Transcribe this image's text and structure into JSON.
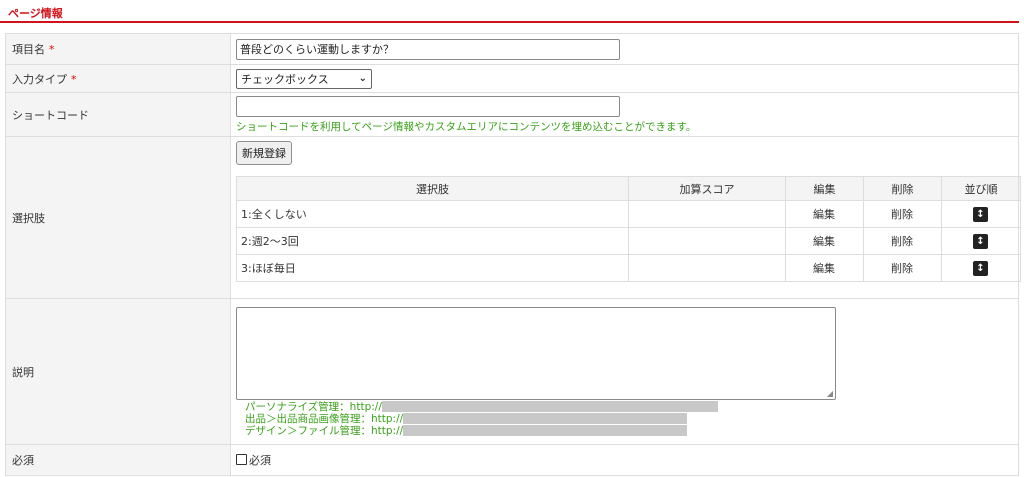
{
  "colors": {
    "accent": "#d0121b",
    "help_text": "#3aa11a",
    "required": "#e60000",
    "header_bg": "#f4f4f4",
    "border": "#dddddd"
  },
  "section": {
    "title": "ページ情報"
  },
  "fields": {
    "item_name": {
      "label": "項目名",
      "required_mark": "*",
      "value": "普段どのくらい運動しますか？"
    },
    "input_type": {
      "label": "入力タイプ",
      "required_mark": "*",
      "selected": "チェックボックス",
      "icon": "chevron-down-icon"
    },
    "shortcode": {
      "label": "ショートコード",
      "value": "",
      "help": "ショートコードを利用してページ情報やカスタムエリアにコンテンツを埋め込むことができます。"
    },
    "choices": {
      "label": "選択肢",
      "new_button": "新規登録",
      "columns": [
        "選択肢",
        "加算スコア",
        "編集",
        "削除",
        "並び順"
      ],
      "rows": [
        {
          "choice": "1:全くしない",
          "score": "",
          "edit": "編集",
          "delete": "削除",
          "sort_icon": "sort-handle-icon"
        },
        {
          "choice": "2:週2〜3回",
          "score": "",
          "edit": "編集",
          "delete": "削除",
          "sort_icon": "sort-handle-icon"
        },
        {
          "choice": "3:ほぼ毎日",
          "score": "",
          "edit": "編集",
          "delete": "削除",
          "sort_icon": "sort-handle-icon"
        }
      ]
    },
    "description": {
      "label": "説明",
      "value": "",
      "links": [
        "パーソナライズ管理：http://",
        "出品＞出品商品画像管理：http://",
        "デザイン＞ファイル管理：http://"
      ]
    },
    "required": {
      "label": "必須",
      "checkbox_label": "必須",
      "checked": false
    }
  }
}
